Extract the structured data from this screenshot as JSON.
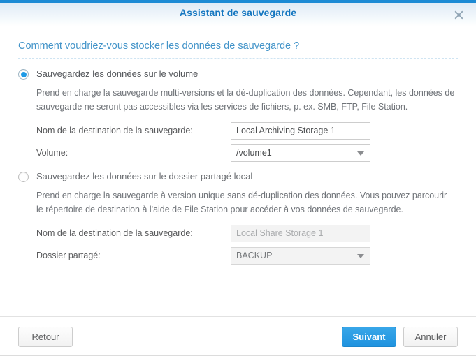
{
  "window": {
    "title": "Assistant de sauvegarde",
    "close_icon": "close-icon",
    "accent_color": "#1c8ad4"
  },
  "heading": "Comment voudriez-vous stocker les données de sauvegarde ?",
  "options": [
    {
      "id": "volume",
      "selected": true,
      "label": "Sauvegardez les données sur le volume",
      "description": "Prend en charge la sauvegarde multi-versions et la dé-duplication des données. Cependant, les données de sauvegarde ne seront pas accessibles via les services de fichiers, p. ex. SMB, FTP, File Station.",
      "fields": [
        {
          "label": "Nom de la destination de la sauvegarde:",
          "type": "text",
          "value": "Local Archiving Storage 1",
          "disabled": false
        },
        {
          "label": "Volume:",
          "type": "select",
          "value": "/volume1",
          "disabled": false
        }
      ]
    },
    {
      "id": "shared-folder",
      "selected": false,
      "label": "Sauvegardez les données sur le dossier partagé local",
      "description": "Prend en charge la sauvegarde à version unique sans dé-duplication des données. Vous pouvez parcourir le répertoire de destination à l'aide de File Station pour accéder à vos données de sauvegarde.",
      "fields": [
        {
          "label": "Nom de la destination de la sauvegarde:",
          "type": "text",
          "value": "Local Share Storage 1",
          "disabled": true
        },
        {
          "label": "Dossier partagé:",
          "type": "select",
          "value": "BACKUP",
          "disabled": true
        }
      ]
    }
  ],
  "footer": {
    "back_label": "Retour",
    "next_label": "Suivant",
    "cancel_label": "Annuler",
    "primary_color": "#2f9be0"
  }
}
